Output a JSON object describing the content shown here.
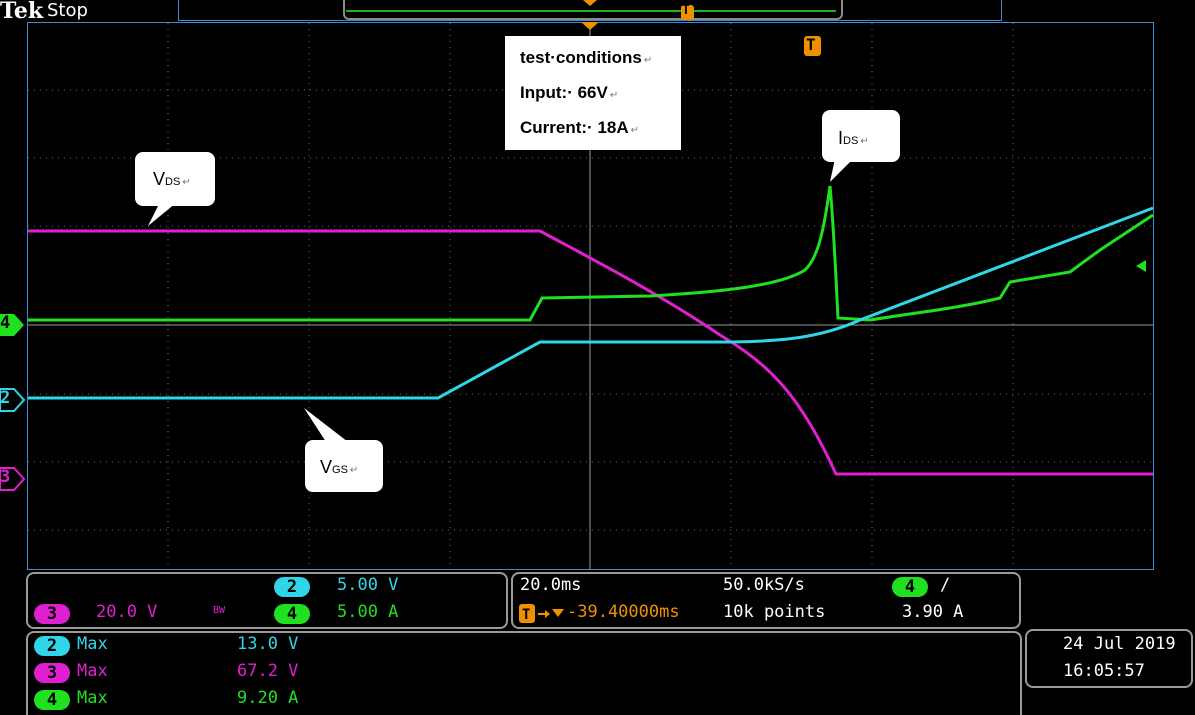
{
  "header": {
    "brand": "Tek",
    "run_state": "Stop"
  },
  "colors": {
    "ch2": "#2fd6e8",
    "ch3": "#e020d0",
    "ch4": "#20e020",
    "trigger": "#f09000",
    "frame": "#3c8fd6"
  },
  "annotations": {
    "test_title": "test·conditions",
    "input": "Input:· 66V",
    "current": "Current:· 18A",
    "return_mark": "↵",
    "vds_main": "V",
    "vds_sub": "DS",
    "vgs_main": "V",
    "vgs_sub": "GS",
    "ids_main": "I",
    "ids_sub": "DS"
  },
  "channel_markers": {
    "ch4": "4",
    "ch2": "2",
    "ch3": "3"
  },
  "scale_panel": {
    "ch2_num": "2",
    "ch2_scale": "5.00 V",
    "ch3_num": "3",
    "ch3_scale": "20.0 V",
    "bw": "BW",
    "ch4_num": "4",
    "ch4_scale": "5.00 A"
  },
  "timebase_panel": {
    "time_div": "20.0ms",
    "sample_rate": "50.0kS/s",
    "trig_ch": "4",
    "trig_slope": "∕",
    "position": "-39.40000ms",
    "record_length": "10k points",
    "trig_level": "3.90 A"
  },
  "measure_panel": {
    "rows": [
      {
        "ch": "2",
        "label": "Max",
        "value": "13.0 V"
      },
      {
        "ch": "3",
        "label": "Max",
        "value": "67.2 V"
      },
      {
        "ch": "4",
        "label": "Max",
        "value": "9.20 A"
      }
    ]
  },
  "datetime": {
    "date": "24 Jul  2019",
    "time": "16:05:57"
  },
  "trigger_marker": "T"
}
